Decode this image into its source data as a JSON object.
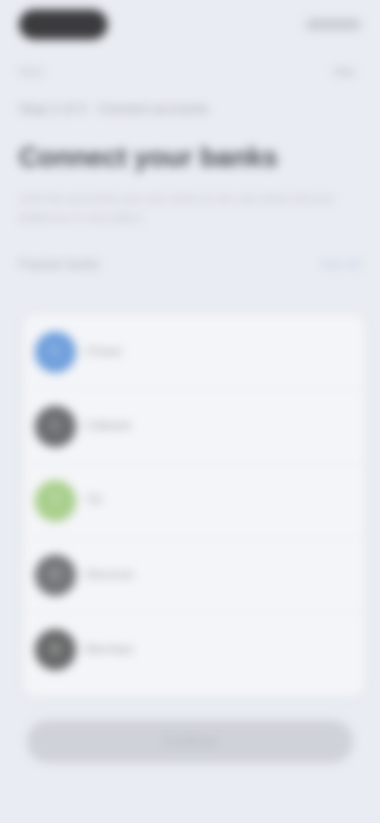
{
  "status_bar": {
    "time": "9:41",
    "icons": "signal-wifi-battery"
  },
  "nav": {
    "back_label": "Back",
    "skip_label": "Skip"
  },
  "breadcrumb": "Step 2 of 3 · Connect accounts",
  "page": {
    "title": "Connect your banks",
    "subtitle": "Link the accounts you use most so we can show all your balances in one place."
  },
  "section": {
    "label": "Popular banks",
    "action_label": "See all"
  },
  "banks": [
    {
      "name": "Chase",
      "initial": "C",
      "color": "#6f9fdc"
    },
    {
      "name": "Citibank",
      "initial": "C",
      "color": "#6b6c6f"
    },
    {
      "name": "TD",
      "initial": "T",
      "color": "#a8cf8c"
    },
    {
      "name": "Discover",
      "initial": "D",
      "color": "#737579"
    },
    {
      "name": "Barclays",
      "initial": "B",
      "color": "#656968"
    }
  ],
  "primary_button_label": "Continue"
}
